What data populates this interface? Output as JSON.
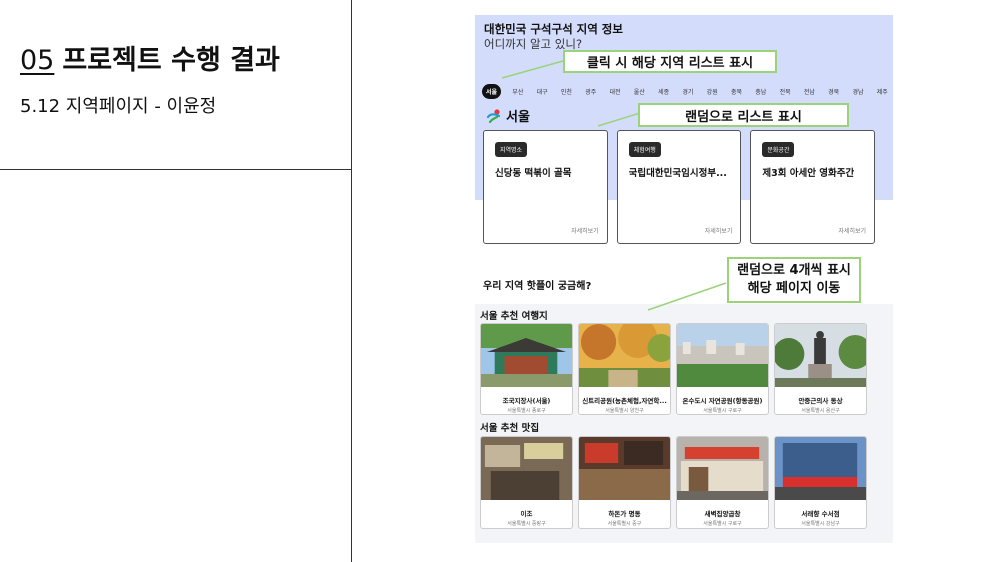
{
  "slide": {
    "section_number": "05",
    "section_title": "프로젝트 수행 결과",
    "subtitle": "5.12 지역페이지 - 이윤정"
  },
  "mockup": {
    "title": "대한민국 구석구석 지역 정보",
    "subtitle": "어디까지 알고 있니?",
    "region_tabs": [
      "서울",
      "부산",
      "대구",
      "인천",
      "광주",
      "대전",
      "울산",
      "세종",
      "경기",
      "강원",
      "충북",
      "충남",
      "전북",
      "전남",
      "경북",
      "경남",
      "제주"
    ],
    "active_region": "서울",
    "region_heading": "서울",
    "cards": [
      {
        "tag": "지역명소",
        "title": "신당동 떡볶이 골목",
        "more": "자세히보기"
      },
      {
        "tag": "체험여행",
        "title": "국립대한민국임시정부...",
        "more": "자세히보기"
      },
      {
        "tag": "문화공간",
        "title": "제3회 아세안 영화주간",
        "more": "자세히보기"
      }
    ],
    "question": "우리 지역 핫플이 궁금해?",
    "tour_heading": "서울 추천 여행지",
    "tour_items": [
      {
        "name": "조국지장사(서울)",
        "location": "서울특별시 종로구"
      },
      {
        "name": "신트리공원(농촌체험,자연학...",
        "location": "서울특별시 양천구"
      },
      {
        "name": "온수도시 자연공원(항동공원)",
        "location": "서울특별시 구로구"
      },
      {
        "name": "안중근의사 동상",
        "location": "서울특별시 용산구"
      }
    ],
    "food_heading": "서울 추천 맛집",
    "food_items": [
      {
        "name": "이조",
        "location": "서울특별시 중랑구"
      },
      {
        "name": "하돈가 명동",
        "location": "서울특별시 중구"
      },
      {
        "name": "새벽집양곱창",
        "location": "서울특별시 구로구"
      },
      {
        "name": "서래향 수서점",
        "location": "서울특별시 강남구"
      }
    ]
  },
  "annotations": {
    "click_note": "클릭 시 해당 지역 리스트 표시",
    "random_list_note": "랜덤으로 리스트 표시",
    "random_four_line1": "랜덤으로 4개씩 표시",
    "random_four_line2": "해당 페이지 이동"
  },
  "colors": {
    "annotation_border": "#9bd37a",
    "mock_header_bg": "#d3dcfb",
    "tag_bg": "#2a2a2a"
  }
}
